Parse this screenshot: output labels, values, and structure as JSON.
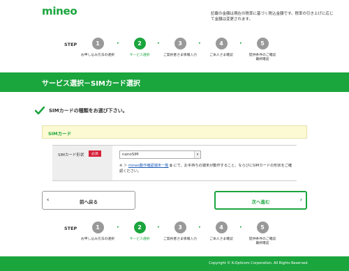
{
  "header": {
    "logo": "mineo",
    "tax_note": "記載の金額は現在の税率に基づく税込金額です。税率の引き上げに応じて金額は変更されます。"
  },
  "steps": {
    "label": "STEP",
    "items": [
      {
        "number": "1",
        "text": "お申し込み方法の選択",
        "active": false
      },
      {
        "number": "2",
        "text": "サービス選択",
        "active": true
      },
      {
        "number": "3",
        "text": "ご契約者さま情報入力",
        "active": false
      },
      {
        "number": "4",
        "text": "ご本人さま確認",
        "active": false
      },
      {
        "number": "5",
        "text": "提供条件のご確認\n最終確認",
        "active": false
      }
    ],
    "arrow": "▸"
  },
  "banner": {
    "title": "サービス選択－SIMカード選択"
  },
  "section": {
    "heading": "SIMカードの種類をお選び下さい。"
  },
  "sim_bar": {
    "label": "SIMカード"
  },
  "form": {
    "field_label": "SIMカード形状",
    "required_label": "必須",
    "select_value": "nanoSIM",
    "note_prefix": "※ ＞ ",
    "note_link": "mineo動作確認端末一覧",
    "note_suffix": " にて、お手持ちの端末が動作すること、ならびにSIMカードの形状をご確認ください。"
  },
  "buttons": {
    "back_label": "前へ戻る",
    "next_label": "次へ進む"
  },
  "footer": {
    "copyright": "Copyright © K-Opticom Corporation. All Rights Reserved."
  },
  "colors": {
    "brand_green": "#1aa53d",
    "required_red": "#d6223b",
    "sim_bar_bg": "#fcfad3"
  }
}
